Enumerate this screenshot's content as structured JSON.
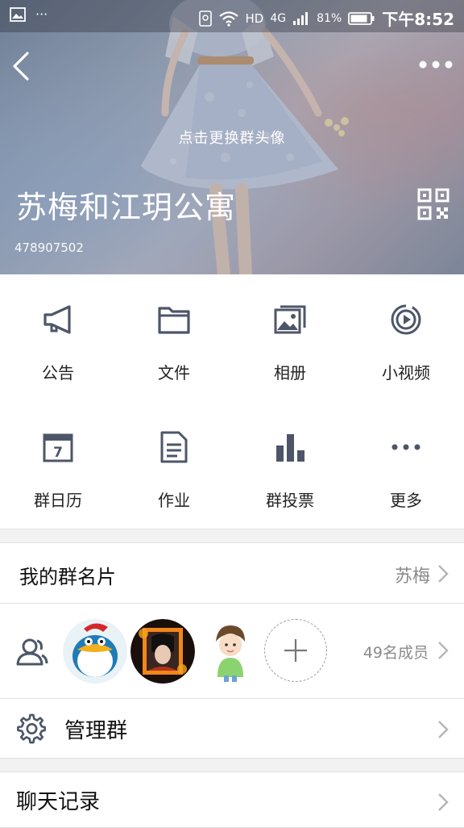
{
  "status_bar": {
    "network": "HD",
    "signal_type": "4G",
    "battery": "81%",
    "time": "下午8:52"
  },
  "header": {
    "change_avatar_hint": "点击更换群头像",
    "group_name": "苏梅和江玥公寓",
    "group_id": "478907502"
  },
  "functions": [
    {
      "label": "公告",
      "icon": "megaphone-icon"
    },
    {
      "label": "文件",
      "icon": "folder-icon"
    },
    {
      "label": "相册",
      "icon": "album-icon"
    },
    {
      "label": "小视频",
      "icon": "video-icon"
    },
    {
      "label": "群日历",
      "icon": "calendar-icon"
    },
    {
      "label": "作业",
      "icon": "document-icon"
    },
    {
      "label": "群投票",
      "icon": "bar-chart-icon"
    },
    {
      "label": "更多",
      "icon": "more-dots-icon"
    }
  ],
  "calendar_day": "7",
  "my_card": {
    "label": "我的群名片",
    "value": "苏梅"
  },
  "members": {
    "count_label": "49名成员"
  },
  "manage": {
    "label": "管理群"
  },
  "chat_history": {
    "label": "聊天记录"
  },
  "colors": {
    "icon": "#4d5669",
    "chevron": "#b5b5b5",
    "divider": "#e0e0e0"
  }
}
